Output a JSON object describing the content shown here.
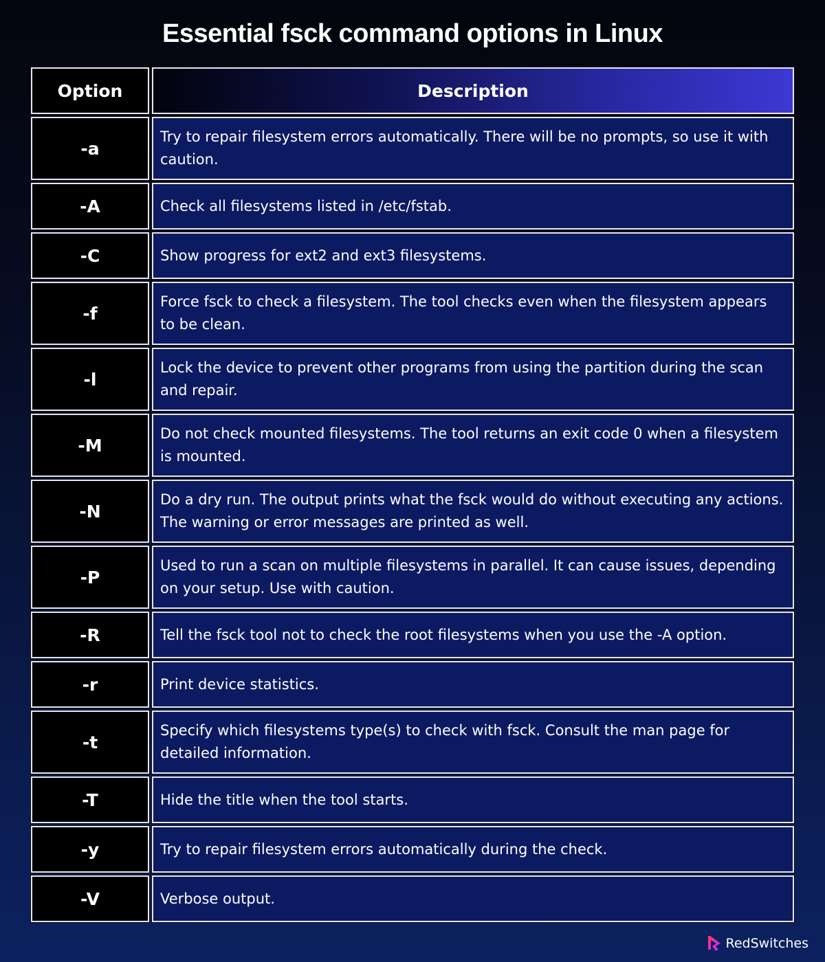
{
  "title": "Essential fsck command options in Linux",
  "table": {
    "headers": {
      "option": "Option",
      "description": "Description"
    },
    "rows": [
      {
        "option": "-a",
        "description": "Try to repair filesystem errors automatically. There will be no prompts, so use it with caution."
      },
      {
        "option": "-A",
        "description": "Check all filesystems listed in /etc/fstab."
      },
      {
        "option": "-C",
        "description": "Show progress for ext2 and ext3 filesystems."
      },
      {
        "option": "-f",
        "description": "Force fsck to check a filesystem. The tool checks even when the filesystem appears to be clean."
      },
      {
        "option": "-l",
        "description": "Lock the device to prevent other programs from using the partition during the scan and repair."
      },
      {
        "option": "-M",
        "description": "Do not check mounted filesystems. The tool returns an exit code 0 when a filesystem is mounted."
      },
      {
        "option": "-N",
        "description": "Do a dry run. The output prints what the fsck would do without executing any actions. The warning or error messages are printed as well."
      },
      {
        "option": "-P",
        "description": "Used to run a scan on multiple filesystems in parallel. It can cause issues, depending on your setup. Use with caution."
      },
      {
        "option": "-R",
        "description": "Tell the fsck tool not to check the root filesystems when you use the -A option."
      },
      {
        "option": "-r",
        "description": "Print device statistics."
      },
      {
        "option": "-t",
        "description": "Specify which filesystems type(s) to check with fsck. Consult the man page for detailed information."
      },
      {
        "option": "-T",
        "description": "Hide the title when the tool starts."
      },
      {
        "option": "-y",
        "description": "Try to repair filesystem errors automatically during the check."
      },
      {
        "option": "-V",
        "description": "Verbose output."
      }
    ]
  },
  "brand": {
    "name": "RedSwitches",
    "logo_icon": "redswitches-logo-icon"
  },
  "colors": {
    "option_cell_bg": "#000000",
    "description_cell_bg": "#0c1a62",
    "header_gradient_end": "#3c38d4",
    "border": "#e6e6ee"
  }
}
